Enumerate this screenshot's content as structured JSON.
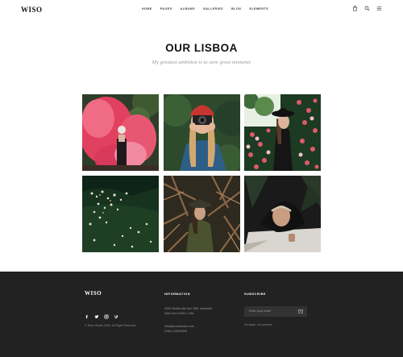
{
  "header": {
    "logo": "WISO",
    "nav": [
      "HOME",
      "PAGES",
      "ALBUMS",
      "GALLERIES",
      "BLOG",
      "ELEMENTS"
    ],
    "icons": [
      "cart-icon",
      "search-icon",
      "menu-icon"
    ]
  },
  "hero": {
    "title": "OUR LISBOA",
    "subtitle": "My greatest ambition is to save great moments"
  },
  "gallery": {
    "photos": [
      "woman-pink-smoke-photo",
      "woman-camera-red-beanie-photo",
      "woman-black-hat-roses-photo",
      "flowers-in-water-photo",
      "woman-hat-branches-photo",
      "woman-headband-lying-photo"
    ]
  },
  "footer": {
    "logo": "WISO",
    "socials": [
      "facebook-icon",
      "twitter-icon",
      "instagram-icon",
      "vimeo-icon"
    ],
    "copyright": "© Wiso Studio 2018. All Right Reserved.",
    "information": {
      "title": "INFORMATION",
      "address_line1": "2005 Stokes Isle Apt. 896, Venaville,",
      "address_line2": "New York 10010, USA",
      "email": "info@yourdomain.com",
      "phone": "(+68) 120034509"
    },
    "subscribe": {
      "title": "SUBSCRIBE",
      "placeholder": "Enter your email",
      "note": "No spam, we promise"
    }
  },
  "colors": {
    "footer_bg": "#222222",
    "input_bg": "#333333",
    "subtitle": "#9a9a9a"
  }
}
